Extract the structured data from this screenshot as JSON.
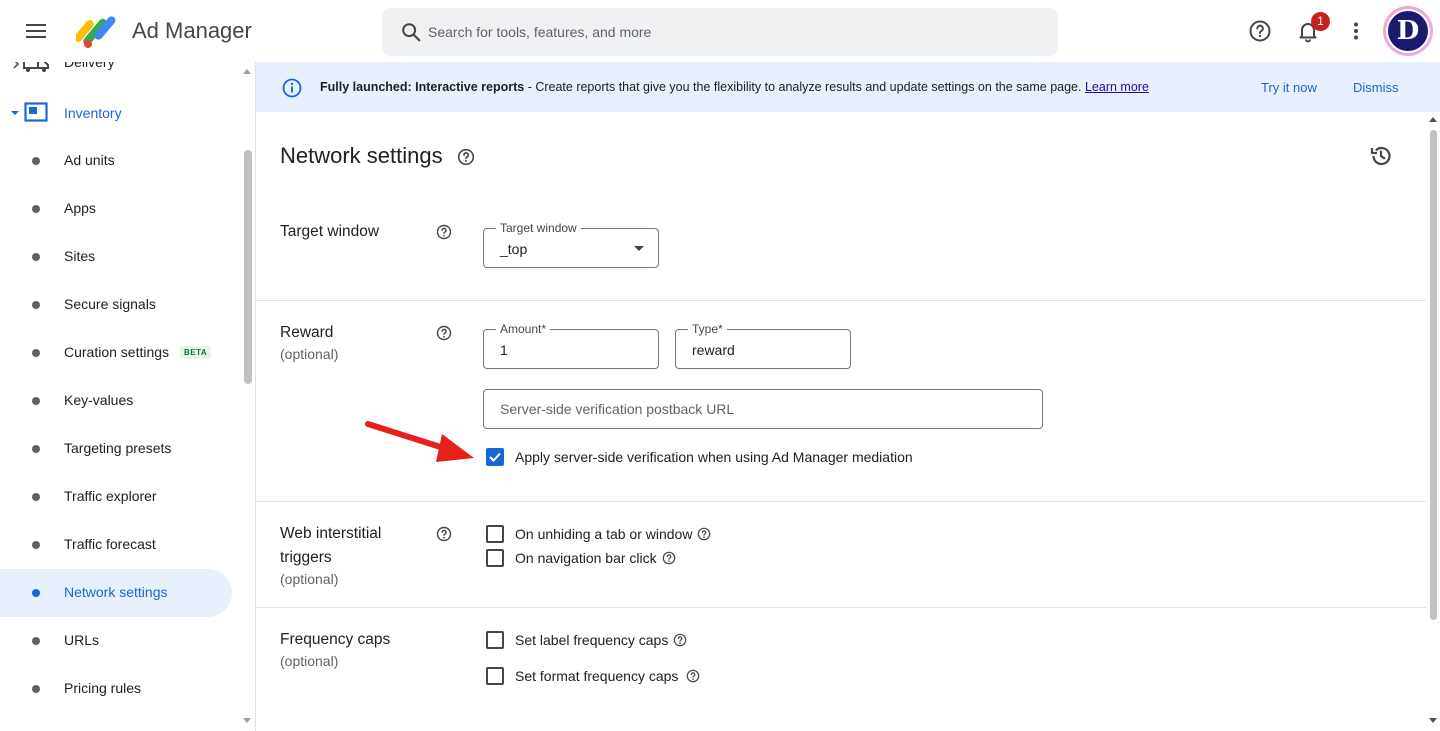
{
  "header": {
    "title": "Ad Manager",
    "search_placeholder": "Search for tools, features, and more",
    "notification_count": "1",
    "avatar_letter": "D"
  },
  "sidebar": {
    "partial_top_item": "Delivery",
    "section": "Inventory",
    "items": [
      {
        "label": "Ad units"
      },
      {
        "label": "Apps"
      },
      {
        "label": "Sites"
      },
      {
        "label": "Secure signals"
      },
      {
        "label": "Curation settings",
        "badge": "BETA"
      },
      {
        "label": "Key-values"
      },
      {
        "label": "Targeting presets"
      },
      {
        "label": "Traffic explorer"
      },
      {
        "label": "Traffic forecast"
      },
      {
        "label": "Network settings",
        "active": true
      },
      {
        "label": "URLs"
      },
      {
        "label": "Pricing rules"
      }
    ]
  },
  "banner": {
    "bold": "Fully launched: Interactive reports",
    "text": " - Create reports that give you the flexibility to analyze results and update settings on the same page. ",
    "link": "Learn more",
    "try_label": "Try it now",
    "dismiss_label": "Dismiss"
  },
  "main": {
    "title": "Network settings",
    "target_window": {
      "label": "Target window",
      "field_label": "Target window",
      "value": "_top"
    },
    "reward": {
      "label": "Reward",
      "optional": "(optional)",
      "amount_label": "Amount*",
      "amount_value": "1",
      "type_label": "Type*",
      "type_value": "reward",
      "url_placeholder": "Server-side verification postback URL",
      "ssv_label": "Apply server-side verification when using Ad Manager mediation"
    },
    "web_interstitial": {
      "label_line1": "Web interstitial",
      "label_line2": "triggers",
      "optional": "(optional)",
      "opt1": "On unhiding a tab or window",
      "opt2": "On navigation bar click"
    },
    "frequency_caps": {
      "label": "Frequency caps",
      "optional": "(optional)",
      "opt1": "Set label frequency caps",
      "opt2": "Set format frequency caps"
    }
  },
  "colors": {
    "accent": "#1967d2",
    "banner_bg": "#e8f0fe",
    "arrow": "#e8201c"
  }
}
